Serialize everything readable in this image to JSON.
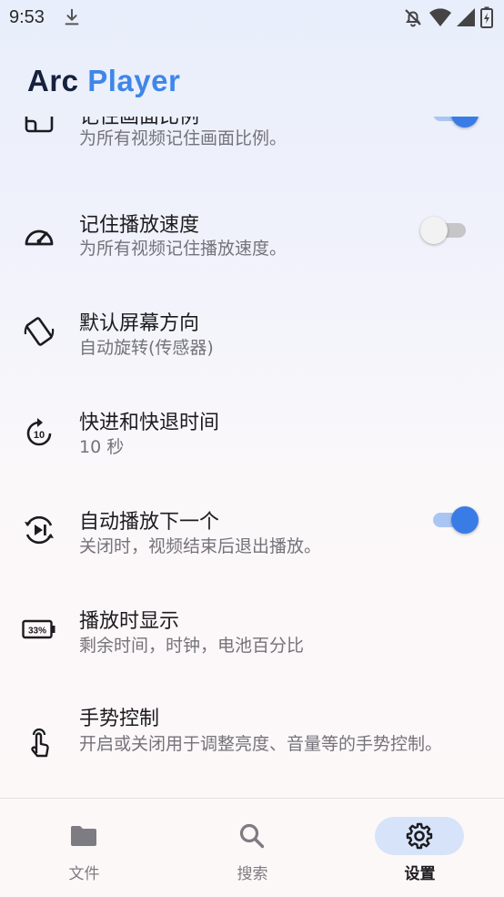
{
  "status_bar": {
    "time": "9:53",
    "icons": [
      "download-icon",
      "notifications-off-icon",
      "wifi-icon",
      "signal-icon",
      "battery-charging-icon"
    ]
  },
  "header": {
    "logo_part1": "Arc",
    "logo_part2": "Player"
  },
  "colors": {
    "accent": "#3a7ce6",
    "logo_dark": "#16213d",
    "logo_blue": "#3f86e9",
    "nav_active": "#d7e3f8"
  },
  "settings": [
    {
      "icon": "aspect-ratio-icon",
      "title": "记住画面比例",
      "subtitle": "为所有视频记住画面比例。",
      "toggle": true
    },
    {
      "icon": "speedometer-icon",
      "title": "记住播放速度",
      "subtitle": "为所有视频记住播放速度。",
      "toggle": false
    },
    {
      "icon": "screen-rotation-icon",
      "title": "默认屏幕方向",
      "subtitle": "自动旋转(传感器)"
    },
    {
      "icon": "forward-10-icon",
      "icon_text": "10",
      "title": "快进和快退时间",
      "subtitle": "10 秒"
    },
    {
      "icon": "autoplay-next-icon",
      "title": "自动播放下一个",
      "subtitle": "关闭时，视频结束后退出播放。",
      "toggle": true
    },
    {
      "icon": "battery-percent-icon",
      "icon_text": "33%",
      "title": "播放时显示",
      "subtitle": "剩余时间，时钟，电池百分比"
    },
    {
      "icon": "gesture-touch-icon",
      "title": "手势控制",
      "subtitle": "开启或关闭用于调整亮度、音量等的手势控制。"
    }
  ],
  "bottom_nav": [
    {
      "icon": "folder-icon",
      "label": "文件",
      "active": false
    },
    {
      "icon": "search-icon",
      "label": "搜索",
      "active": false
    },
    {
      "icon": "settings-gear-icon",
      "label": "设置",
      "active": true
    }
  ]
}
